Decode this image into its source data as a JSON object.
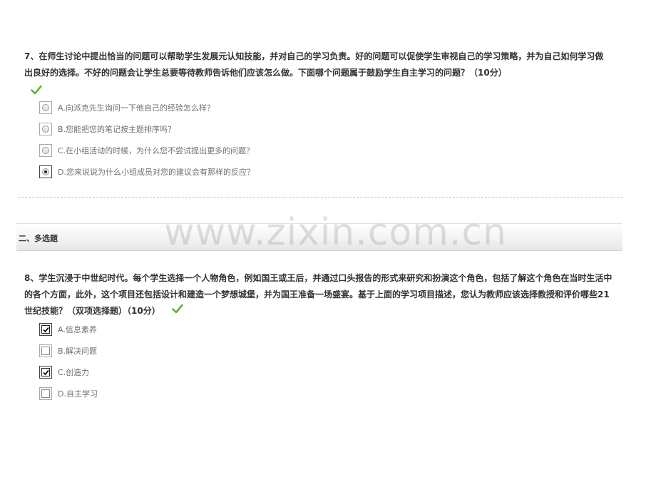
{
  "q7": {
    "text": "7、在师生讨论中提出恰当的问题可以帮助学生发展元认知技能，并对自己的学习负责。好的问题可以促使学生审视自己的学习策略，并为自己如何学习做出良好的选择。不好的问题会让学生总要等待教师告诉他们应该怎么做。下面哪个问题属于鼓励学生自主学习的问题？（10分）",
    "options": [
      {
        "label": "A.向派克先生询问一下他自己的经验怎么样？",
        "selected": false
      },
      {
        "label": "B.您能把您的笔记按主题排序吗？",
        "selected": false
      },
      {
        "label": "C.在小组活动的时候，为什么您不尝试提出更多的问题？",
        "selected": false
      },
      {
        "label": "D.您来说说为什么小组成员对您的建议会有那样的反应？",
        "selected": true
      }
    ]
  },
  "section": {
    "title": "二、多选题"
  },
  "watermark": "www.zixin.com.cn",
  "q8": {
    "text": "8、学生沉浸于中世纪时代。每个学生选择一个人物角色，例如国王或王后，并通过口头报告的形式来研究和扮演这个角色，包括了解这个角色在当时生活中的各个方面，此外，这个项目还包括设计和建造一个梦想城堡，并为国王准备一场盛宴。基于上面的学习项目描述，您认为教师应该选择教授和评价哪些21世纪技能？（双项选择题）（10分）",
    "options": [
      {
        "label": "A.信息素养",
        "checked": true
      },
      {
        "label": "B.解决问题",
        "checked": false
      },
      {
        "label": "C.创造力",
        "checked": true
      },
      {
        "label": "D.自主学习",
        "checked": false
      }
    ]
  },
  "colors": {
    "check": "#5cb531",
    "text": "#333333",
    "option_text": "#6f6f6f"
  }
}
